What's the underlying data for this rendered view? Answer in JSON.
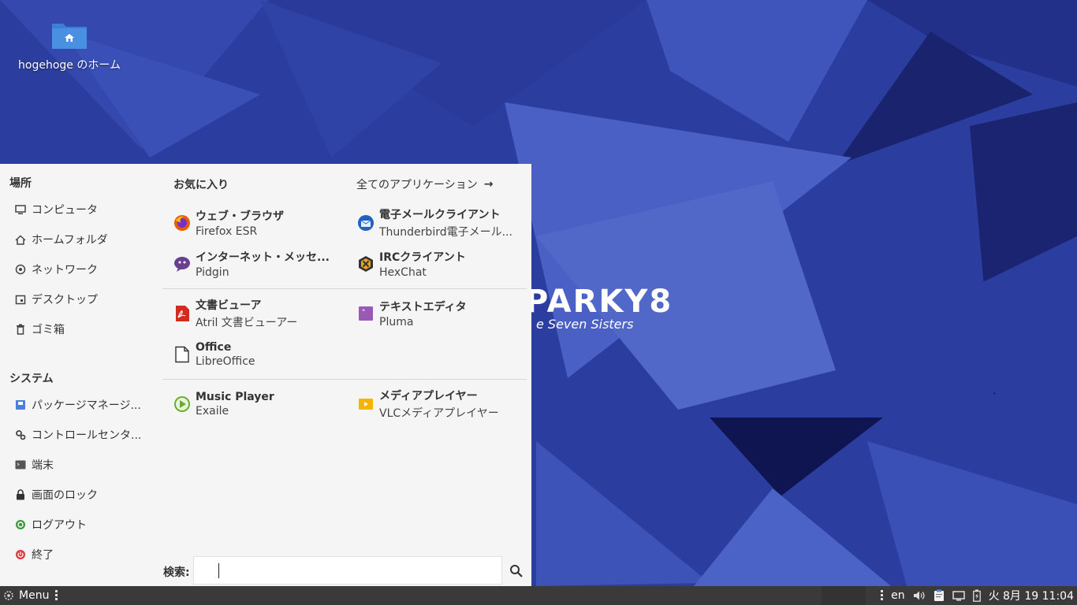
{
  "desktop": {
    "home_icon_label": "hogehoge のホーム",
    "brand_text": "PARKY8",
    "brand_tagline": "e Seven Sisters"
  },
  "places": {
    "heading": "場所",
    "items": [
      {
        "label": "コンピュータ",
        "icon": "monitor-icon"
      },
      {
        "label": "ホームフォルダ",
        "icon": "home-icon"
      },
      {
        "label": "ネットワーク",
        "icon": "network-icon"
      },
      {
        "label": "デスクトップ",
        "icon": "desktop-icon"
      },
      {
        "label": "ゴミ箱",
        "icon": "trash-icon"
      }
    ]
  },
  "system": {
    "heading": "システム",
    "items": [
      {
        "label": "パッケージマネージ...",
        "icon": "package-icon"
      },
      {
        "label": "コントロールセンタ...",
        "icon": "settings-icon"
      },
      {
        "label": "端末",
        "icon": "terminal-icon"
      },
      {
        "label": "画面のロック",
        "icon": "lock-icon"
      },
      {
        "label": "ログアウト",
        "icon": "logout-icon"
      },
      {
        "label": "終了",
        "icon": "power-icon"
      }
    ]
  },
  "favorites": {
    "heading": "お気に入り",
    "all_apps_label": "全てのアプリケーション",
    "apps": [
      {
        "name": "ウェブ・ブラウザ",
        "sub": "Firefox ESR",
        "icon": "firefox-icon"
      },
      {
        "name": "電子メールクライアント",
        "sub": "Thunderbird電子メール...",
        "icon": "thunderbird-icon"
      },
      {
        "name": "インターネット・メッセ...",
        "sub": "Pidgin",
        "icon": "pidgin-icon"
      },
      {
        "name": "IRCクライアント",
        "sub": "HexChat",
        "icon": "hexchat-icon"
      },
      {
        "name": "文書ビューア",
        "sub": "Atril 文書ビューアー",
        "icon": "pdf-icon"
      },
      {
        "name": "テキストエディタ",
        "sub": "Pluma",
        "icon": "pluma-icon"
      },
      {
        "name": "Office",
        "sub": "LibreOffice",
        "icon": "document-icon"
      },
      {
        "name": "Music Player",
        "sub": "Exaile",
        "icon": "music-player-icon"
      },
      {
        "name": "メディアプレイヤー",
        "sub": "VLCメディアプレイヤー",
        "icon": "media-player-icon"
      }
    ]
  },
  "search": {
    "label": "検索:",
    "value": "",
    "placeholder": ""
  },
  "taskbar": {
    "menu_label": "Menu",
    "lang": "en",
    "clock": "火  8月 19 11:04"
  }
}
